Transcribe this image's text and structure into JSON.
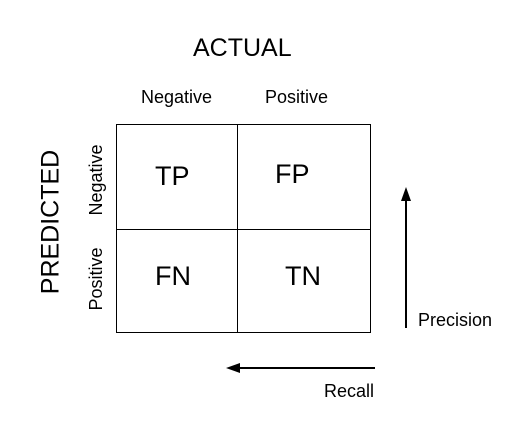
{
  "actual_title": "ACTUAL",
  "predicted_title": "PREDICTED",
  "columns": [
    "Negative",
    "Positive"
  ],
  "rows": [
    "Negative",
    "Positive"
  ],
  "cells": {
    "top_left": "TP",
    "top_right": "FP",
    "bottom_left": "FN",
    "bottom_right": "TN"
  },
  "arrows": {
    "precision_label": "Precision",
    "recall_label": "Recall"
  }
}
